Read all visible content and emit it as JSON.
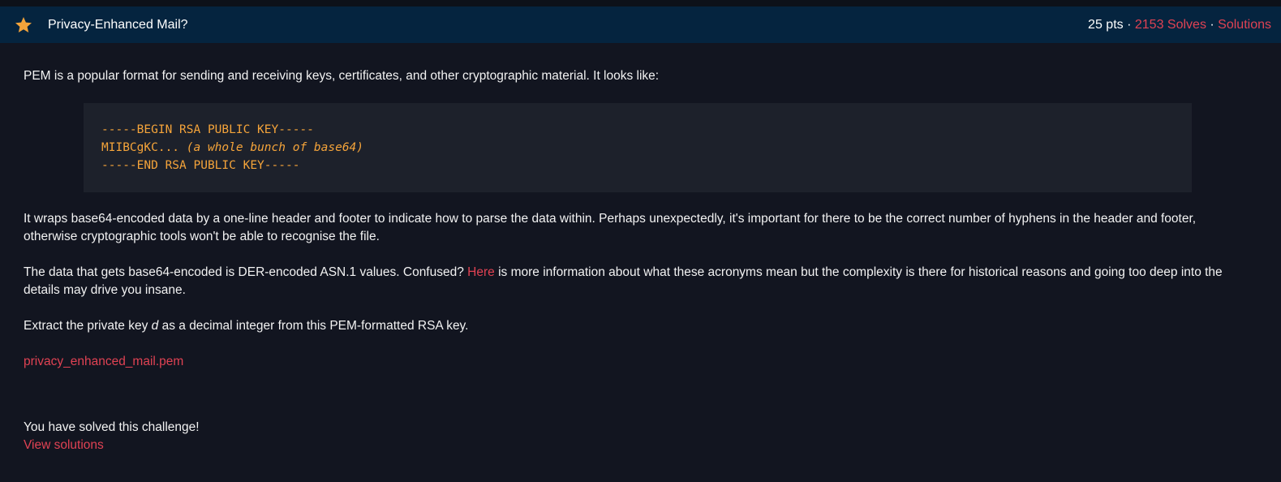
{
  "header": {
    "title": "Privacy-Enhanced Mail?",
    "points": "25 pts",
    "sep1": "·",
    "solves": "2153 Solves",
    "sep2": "·",
    "solutions": "Solutions"
  },
  "body": {
    "intro": "PEM is a popular format for sending and receiving keys, certificates, and other cryptographic material. It looks like:",
    "code": {
      "line1": "-----BEGIN RSA PUBLIC KEY-----",
      "line2_prefix": "MIIBCgKC... ",
      "line2_comment": "(a whole bunch of base64)",
      "line3": "-----END RSA PUBLIC KEY-----"
    },
    "para1": "It wraps base64-encoded data by a one-line header and footer to indicate how to parse the data within. Perhaps unexpectedly, it's important for there to be the correct number of hyphens in the header and footer, otherwise cryptographic tools won't be able to recognise the file.",
    "para2_before": "The data that gets base64-encoded is DER-encoded ASN.1 values. Confused? ",
    "para2_link": "Here",
    "para2_after": " is more information about what these acronyms mean but the complexity is there for historical reasons and going too deep into the details may drive you insane.",
    "para3_before": "Extract the private key ",
    "para3_var": "d",
    "para3_after": " as a decimal integer from this PEM-formatted RSA key.",
    "file_link": "privacy_enhanced_mail.pem",
    "solved_text": "You have solved this challenge!",
    "view_solutions": "View solutions"
  },
  "colors": {
    "background": "#121520",
    "header": "#05243f",
    "accent_red": "#e04253",
    "code_orange": "#f5a43a",
    "star": "#f5a43a"
  }
}
